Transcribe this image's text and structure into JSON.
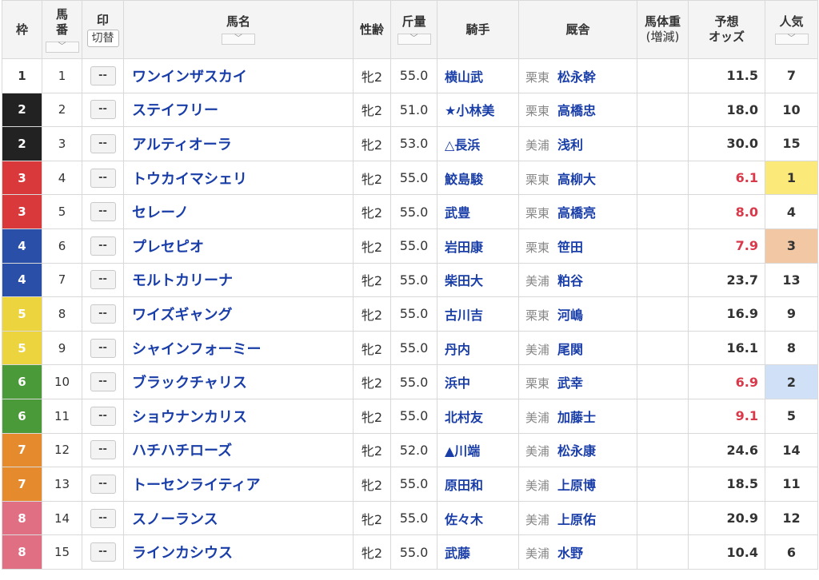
{
  "header": {
    "waku": "枠",
    "umaban_line1": "馬",
    "umaban_line2": "番",
    "mark": "印",
    "mark_switch": "切替",
    "horse_name": "馬名",
    "sex_age": "性齢",
    "weight": "斤量",
    "jockey": "騎手",
    "stable": "厩舎",
    "body_weight_line1": "馬体重",
    "body_weight_line2": "(増減)",
    "odds_line1": "予想",
    "odds_line2": "オッズ",
    "popularity": "人気",
    "sort_glyph": "﹀"
  },
  "colors": {
    "waku": {
      "1": "#ffffff",
      "2": "#222222",
      "3": "#d9393b",
      "4": "#2a4fa8",
      "5": "#ecd43f",
      "6": "#4a9a3a",
      "7": "#e58a2d",
      "8": "#e16f84"
    },
    "waku_text": {
      "1": "#333333",
      "2": "#ffffff",
      "3": "#ffffff",
      "4": "#ffffff",
      "5": "#ffffff",
      "6": "#ffffff",
      "7": "#ffffff",
      "8": "#ffffff"
    },
    "odds_highlight": "#d9394a",
    "pop_1": "#fbe97a",
    "pop_2": "#cfe0f7",
    "pop_3": "#f2c7a4"
  },
  "rows": [
    {
      "waku": "1",
      "umaban": "1",
      "mark": "--",
      "name": "ワンインザスカイ",
      "sex_age": "牝2",
      "weight": "55.0",
      "jockey": "横山武",
      "region": "栗東",
      "trainer": "松永幹",
      "body_weight": "",
      "odds": "11.5",
      "odds_hl": false,
      "pop": "7",
      "pop_hl": ""
    },
    {
      "waku": "2",
      "umaban": "2",
      "mark": "--",
      "name": "ステイフリー",
      "sex_age": "牝2",
      "weight": "51.0",
      "jockey": "★小林美",
      "region": "栗東",
      "trainer": "高橋忠",
      "body_weight": "",
      "odds": "18.0",
      "odds_hl": false,
      "pop": "10",
      "pop_hl": ""
    },
    {
      "waku": "2",
      "umaban": "3",
      "mark": "--",
      "name": "アルティオーラ",
      "sex_age": "牝2",
      "weight": "53.0",
      "jockey": "△長浜",
      "region": "美浦",
      "trainer": "浅利",
      "body_weight": "",
      "odds": "30.0",
      "odds_hl": false,
      "pop": "15",
      "pop_hl": ""
    },
    {
      "waku": "3",
      "umaban": "4",
      "mark": "--",
      "name": "トウカイマシェリ",
      "sex_age": "牝2",
      "weight": "55.0",
      "jockey": "鮫島駿",
      "region": "栗東",
      "trainer": "高柳大",
      "body_weight": "",
      "odds": "6.1",
      "odds_hl": true,
      "pop": "1",
      "pop_hl": "1"
    },
    {
      "waku": "3",
      "umaban": "5",
      "mark": "--",
      "name": "セレーノ",
      "sex_age": "牝2",
      "weight": "55.0",
      "jockey": "武豊",
      "region": "栗東",
      "trainer": "高橋亮",
      "body_weight": "",
      "odds": "8.0",
      "odds_hl": true,
      "pop": "4",
      "pop_hl": ""
    },
    {
      "waku": "4",
      "umaban": "6",
      "mark": "--",
      "name": "プレセピオ",
      "sex_age": "牝2",
      "weight": "55.0",
      "jockey": "岩田康",
      "region": "栗東",
      "trainer": "笹田",
      "body_weight": "",
      "odds": "7.9",
      "odds_hl": true,
      "pop": "3",
      "pop_hl": "3"
    },
    {
      "waku": "4",
      "umaban": "7",
      "mark": "--",
      "name": "モルトカリーナ",
      "sex_age": "牝2",
      "weight": "55.0",
      "jockey": "柴田大",
      "region": "美浦",
      "trainer": "粕谷",
      "body_weight": "",
      "odds": "23.7",
      "odds_hl": false,
      "pop": "13",
      "pop_hl": ""
    },
    {
      "waku": "5",
      "umaban": "8",
      "mark": "--",
      "name": "ワイズギャング",
      "sex_age": "牝2",
      "weight": "55.0",
      "jockey": "古川吉",
      "region": "栗東",
      "trainer": "河嶋",
      "body_weight": "",
      "odds": "16.9",
      "odds_hl": false,
      "pop": "9",
      "pop_hl": ""
    },
    {
      "waku": "5",
      "umaban": "9",
      "mark": "--",
      "name": "シャインフォーミー",
      "sex_age": "牝2",
      "weight": "55.0",
      "jockey": "丹内",
      "region": "美浦",
      "trainer": "尾関",
      "body_weight": "",
      "odds": "16.1",
      "odds_hl": false,
      "pop": "8",
      "pop_hl": ""
    },
    {
      "waku": "6",
      "umaban": "10",
      "mark": "--",
      "name": "ブラックチャリス",
      "sex_age": "牝2",
      "weight": "55.0",
      "jockey": "浜中",
      "region": "栗東",
      "trainer": "武幸",
      "body_weight": "",
      "odds": "6.9",
      "odds_hl": true,
      "pop": "2",
      "pop_hl": "2"
    },
    {
      "waku": "6",
      "umaban": "11",
      "mark": "--",
      "name": "ショウナンカリス",
      "sex_age": "牝2",
      "weight": "55.0",
      "jockey": "北村友",
      "region": "美浦",
      "trainer": "加藤士",
      "body_weight": "",
      "odds": "9.1",
      "odds_hl": true,
      "pop": "5",
      "pop_hl": ""
    },
    {
      "waku": "7",
      "umaban": "12",
      "mark": "--",
      "name": "ハチハチローズ",
      "sex_age": "牝2",
      "weight": "52.0",
      "jockey": "▲川端",
      "region": "美浦",
      "trainer": "松永康",
      "body_weight": "",
      "odds": "24.6",
      "odds_hl": false,
      "pop": "14",
      "pop_hl": ""
    },
    {
      "waku": "7",
      "umaban": "13",
      "mark": "--",
      "name": "トーセンライティア",
      "sex_age": "牝2",
      "weight": "55.0",
      "jockey": "原田和",
      "region": "美浦",
      "trainer": "上原博",
      "body_weight": "",
      "odds": "18.5",
      "odds_hl": false,
      "pop": "11",
      "pop_hl": ""
    },
    {
      "waku": "8",
      "umaban": "14",
      "mark": "--",
      "name": "スノーランス",
      "sex_age": "牝2",
      "weight": "55.0",
      "jockey": "佐々木",
      "region": "美浦",
      "trainer": "上原佑",
      "body_weight": "",
      "odds": "20.9",
      "odds_hl": false,
      "pop": "12",
      "pop_hl": ""
    },
    {
      "waku": "8",
      "umaban": "15",
      "mark": "--",
      "name": "ラインカシウス",
      "sex_age": "牝2",
      "weight": "55.0",
      "jockey": "武藤",
      "region": "美浦",
      "trainer": "水野",
      "body_weight": "",
      "odds": "10.4",
      "odds_hl": false,
      "pop": "6",
      "pop_hl": ""
    }
  ]
}
